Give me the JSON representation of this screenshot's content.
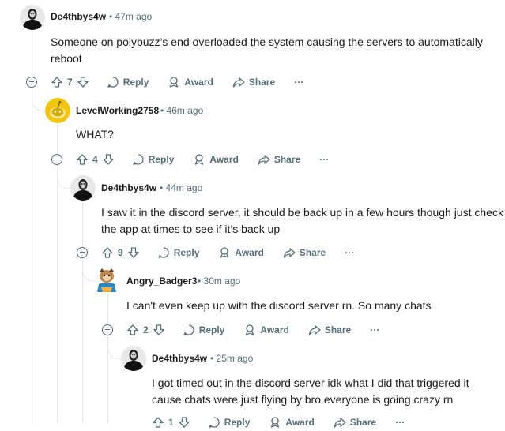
{
  "comments": [
    {
      "username": "De4thbys4w",
      "time": "47m ago",
      "body": "Someone on polybuzz’s end overloaded the system causing the servers to automatically reboot",
      "votes": "7",
      "reply_label": "Reply",
      "award_label": "Award",
      "share_label": "Share",
      "more_label": "···"
    },
    {
      "username": "LevelWorking2758",
      "time": "46m ago",
      "body": "WHAT?",
      "votes": "4",
      "reply_label": "Reply",
      "award_label": "Award",
      "share_label": "Share",
      "more_label": "···"
    },
    {
      "username": "De4thbys4w",
      "time": "44m ago",
      "body": "I saw it in the discord server, it should be back up in a few hours though just check the app at times to see if it’s back up",
      "votes": "9",
      "reply_label": "Reply",
      "award_label": "Award",
      "share_label": "Share",
      "more_label": "···"
    },
    {
      "username": "Angry_Badger3",
      "time": "30m ago",
      "body": "I can't even keep up with the discord server rn. So many chats",
      "votes": "2",
      "reply_label": "Reply",
      "award_label": "Award",
      "share_label": "Share",
      "more_label": "···"
    },
    {
      "username": "De4thbys4w",
      "time": "25m ago",
      "body": "I got timed out in the discord server idk what I did that triggered it cause chats were just flying by bro everyone is going crazy rn",
      "votes": "1",
      "reply_label": "Reply",
      "award_label": "Award",
      "share_label": "Share",
      "more_label": "···"
    }
  ],
  "separator": "•",
  "colors": {
    "text": "#1c1c1c",
    "meta": "#576f76",
    "thread_line": "#e5e7eb",
    "snoo_yellow": "#f1c40f"
  }
}
